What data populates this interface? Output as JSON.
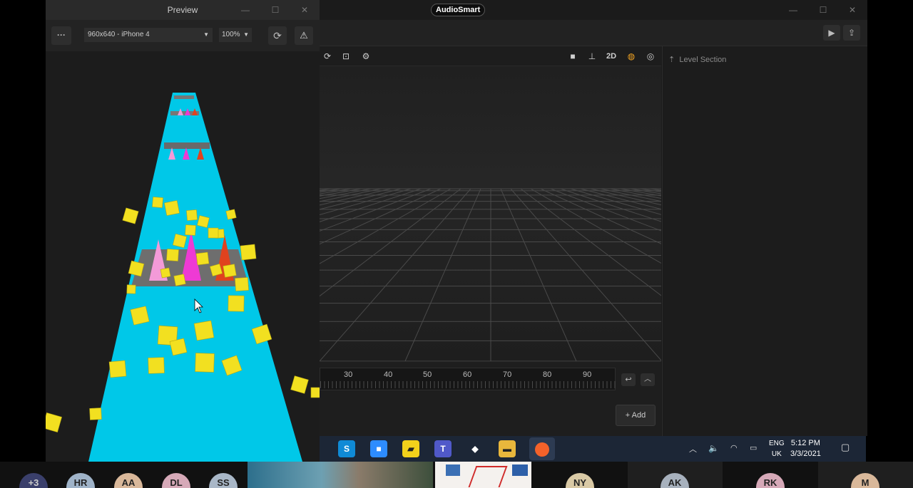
{
  "editor": {
    "app_title": "AudioSmart",
    "right_panel": {
      "title": "Level Section"
    },
    "add_label": "+ Add",
    "timeline_ticks": [
      "30",
      "40",
      "50",
      "60",
      "70",
      "80",
      "90"
    ],
    "viewport_toggle_2d": "2D"
  },
  "preview": {
    "title": "Preview",
    "more_label": "···",
    "device": "960x640 - iPhone 4",
    "zoom": "100%"
  },
  "taskbar": {
    "lang_line1": "ENG",
    "lang_line2": "UK",
    "time": "5:12 PM",
    "date": "3/3/2021",
    "apps": [
      "skype-icon",
      "zoom-icon",
      "sticky-notes-icon",
      "teams-icon",
      "cube-app-icon",
      "file-explorer-icon",
      "active-app-icon"
    ]
  },
  "participants": [
    "+3",
    "HR",
    "AA",
    "DL",
    "SS",
    "NY",
    "AK",
    "RK",
    "M"
  ],
  "colors": {
    "track": "#00c8e8",
    "cube": "#f2e020",
    "cone_pink": "#ee3ad4",
    "cone_light_pink": "#f39ad8",
    "cone_red": "#e0421e",
    "accent_orange": "#f5a623"
  }
}
